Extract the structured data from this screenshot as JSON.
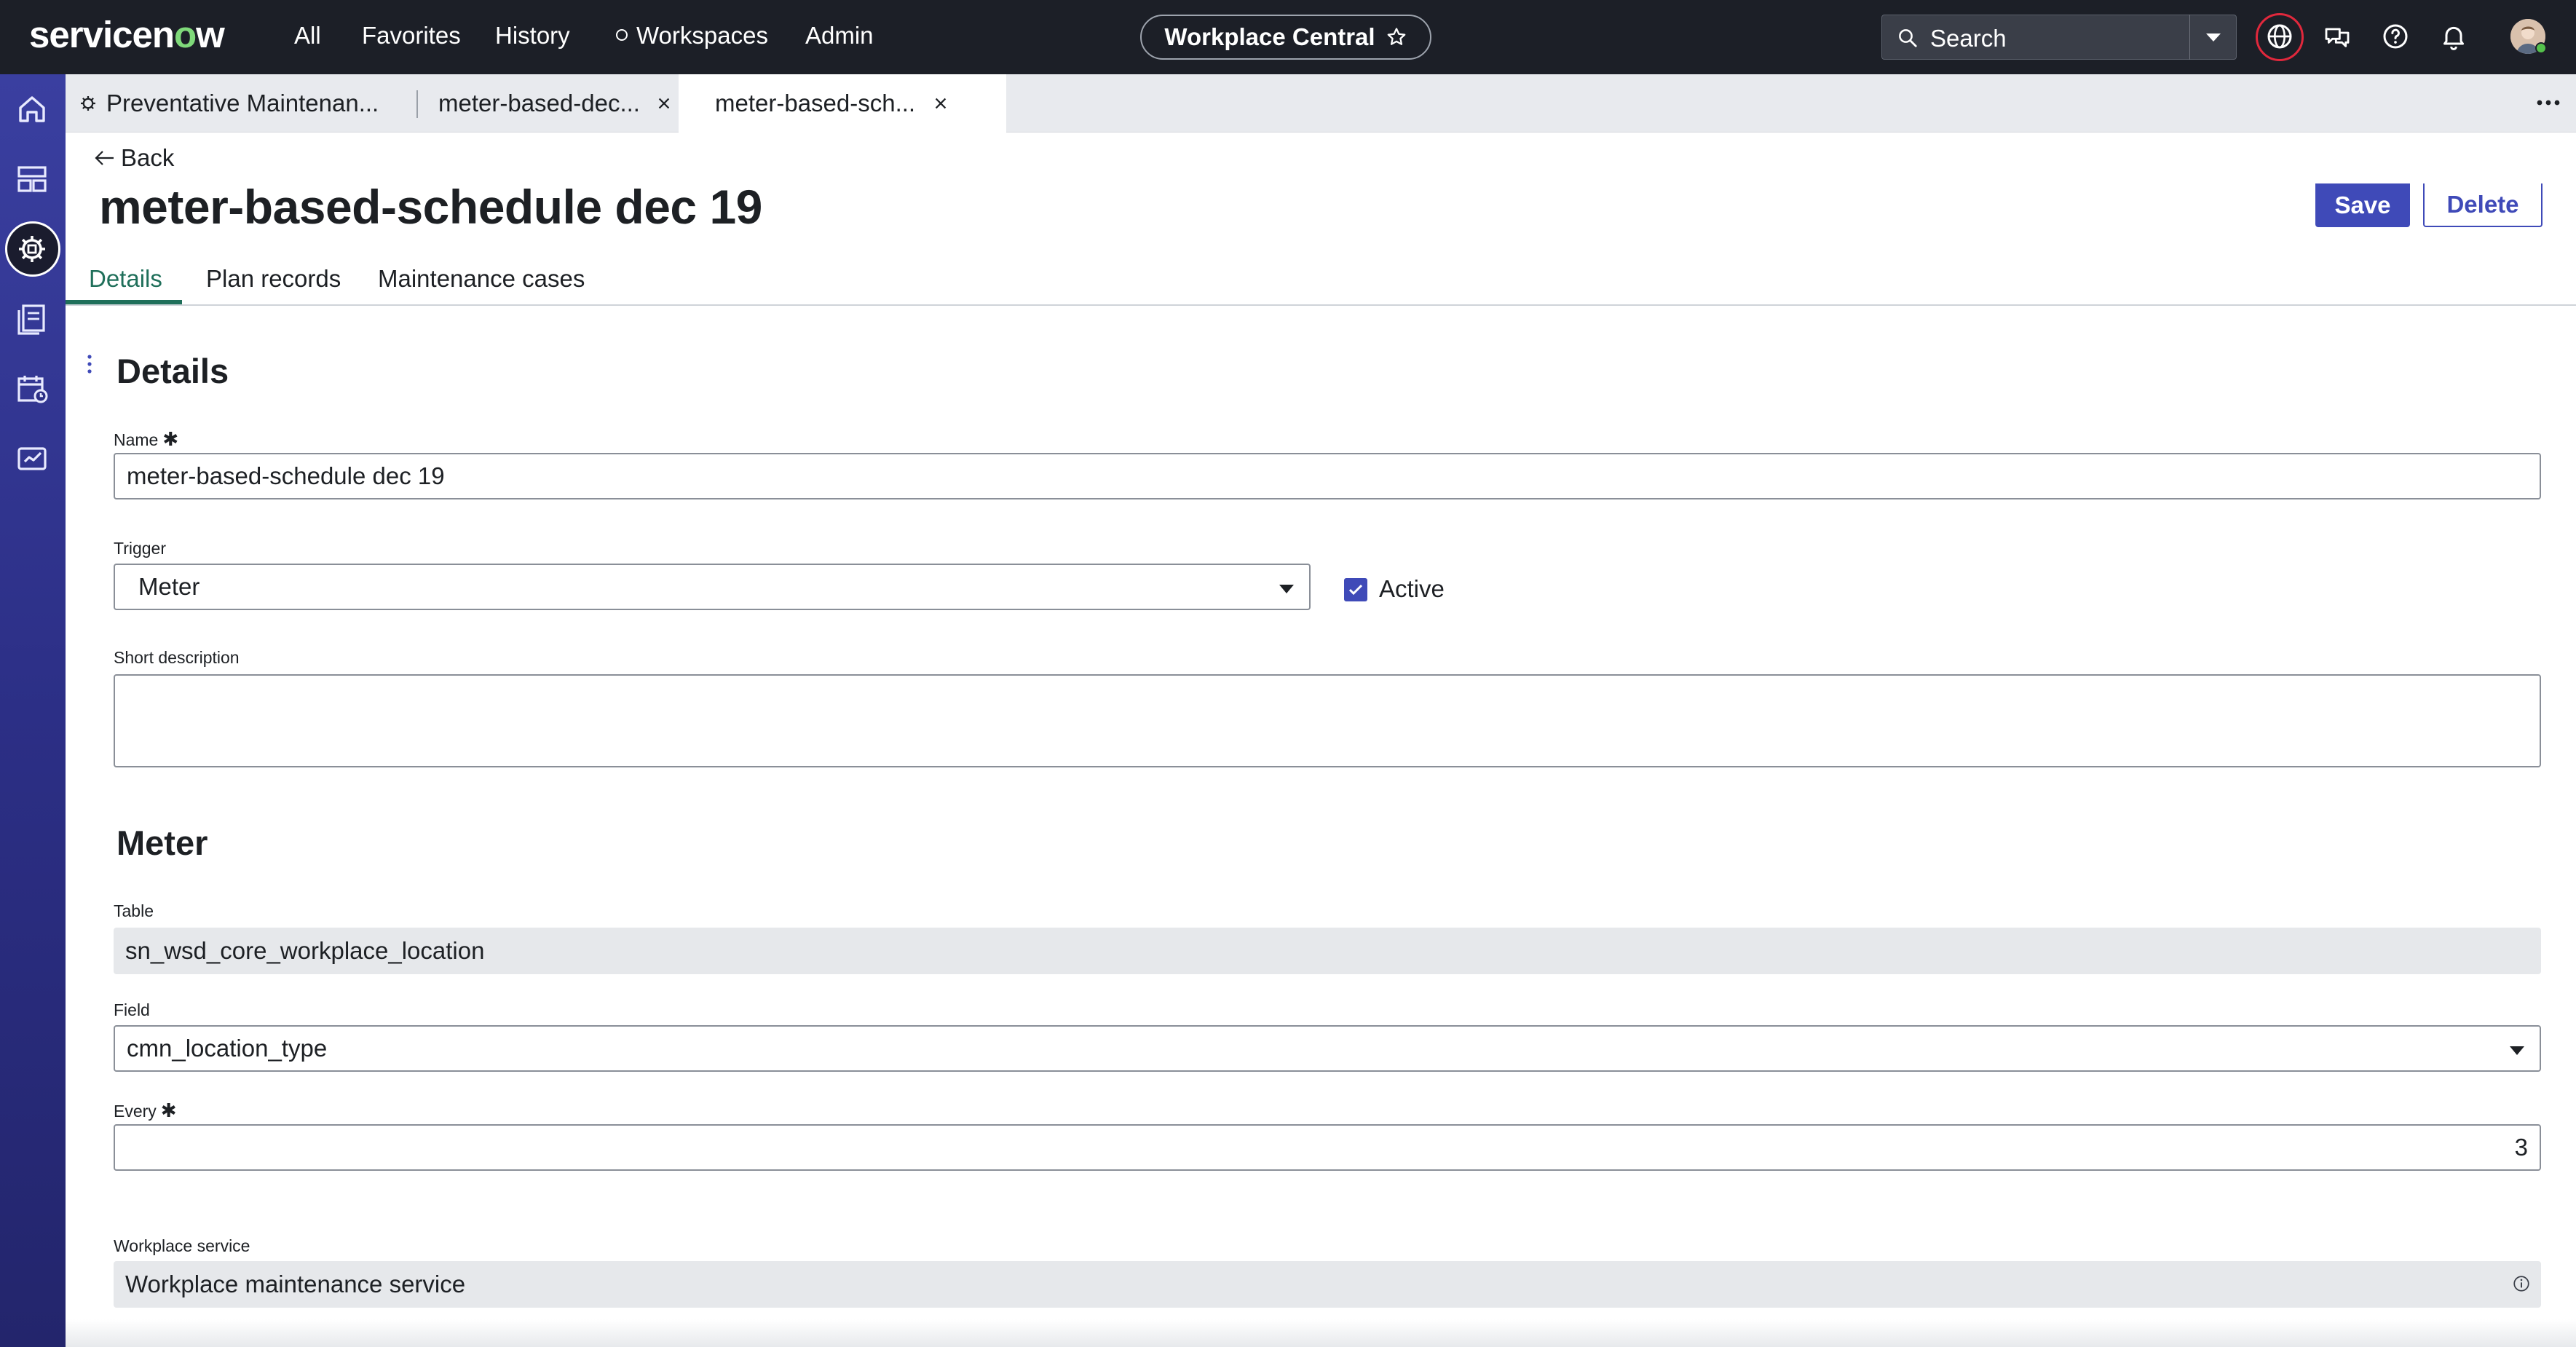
{
  "header": {
    "logo": {
      "a": "servicen",
      "o": "o",
      "b": "w"
    },
    "nav": [
      "All",
      "Favorites",
      "History",
      "Workspaces",
      "Admin"
    ],
    "workspace_pill": "Workplace Central",
    "search_placeholder": "Search"
  },
  "rail": {
    "icons": [
      "home-icon",
      "workspace-list-icon",
      "maintenance-icon",
      "records-icon",
      "calendar-icon",
      "analytics-icon"
    ],
    "active": "maintenance-icon"
  },
  "tabs": [
    {
      "label": "Preventative Maintenan...",
      "closable": false,
      "active": false
    },
    {
      "label": "meter-based-dec...",
      "closable": true,
      "active": false
    },
    {
      "label": "meter-based-sch...",
      "closable": true,
      "active": true
    }
  ],
  "page": {
    "back_label": "Back",
    "title": "meter-based-schedule dec 19",
    "save_label": "Save",
    "delete_label": "Delete"
  },
  "subtabs": [
    "Details",
    "Plan records",
    "Maintenance cases"
  ],
  "form": {
    "details_heading": "Details",
    "name_label": "Name",
    "required_mark": "✱",
    "name_value": "meter-based-schedule dec 19",
    "trigger_label": "Trigger",
    "trigger_value": "Meter",
    "active_label": "Active",
    "active_checked": true,
    "short_desc_label": "Short description",
    "short_desc_value": "",
    "meter_heading": "Meter",
    "table_label": "Table",
    "table_value": "sn_wsd_core_workplace_location",
    "field_label": "Field",
    "field_value": "cmn_location_type",
    "every_label": "Every",
    "every_value": "3",
    "service_label": "Workplace service",
    "service_value": "Workplace maintenance service"
  },
  "colors": {
    "header_bg": "#1c1f27",
    "rail_top": "#3a3fa0",
    "primary": "#3f4ab8",
    "active_tab": "#1f6f5a",
    "logo_accent": "#7fd97a",
    "alert_ring": "#e0283c"
  }
}
